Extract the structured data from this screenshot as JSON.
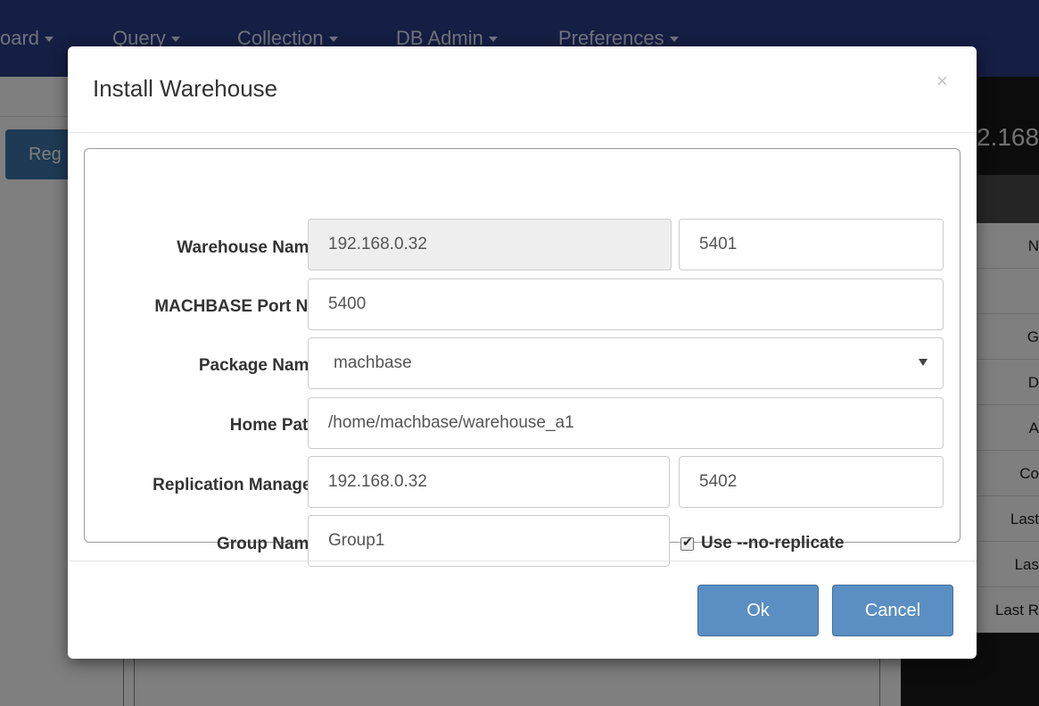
{
  "navbar": {
    "items": [
      {
        "label": "oard"
      },
      {
        "label": "Query"
      },
      {
        "label": "Collection"
      },
      {
        "label": "DB Admin"
      },
      {
        "label": "Preferences"
      }
    ]
  },
  "background": {
    "button_label": "Reg",
    "right_title": "2.168",
    "table_cells": [
      "N",
      "",
      "G",
      "D",
      "A",
      "Co",
      "Last",
      "Las",
      "Last R"
    ]
  },
  "modal": {
    "title": "Install Warehouse",
    "close_symbol": "×",
    "fields": {
      "warehouse_name": {
        "label": "Warehouse Name",
        "value": "192.168.0.32",
        "port": "5401"
      },
      "machbase_port": {
        "label": "MACHBASE Port No",
        "value": "5400"
      },
      "package_name": {
        "label": "Package Name",
        "value": "machbase"
      },
      "home_path": {
        "label": "Home Path",
        "value": "/home/machbase/warehouse_a1"
      },
      "replication_manager": {
        "label": "Replication Manager",
        "value": "192.168.0.32",
        "port": "5402"
      },
      "group_name": {
        "label": "Group Name",
        "value": "Group1"
      }
    },
    "no_replicate": {
      "label": "Use --no-replicate",
      "checked": true
    },
    "buttons": {
      "ok": "Ok",
      "cancel": "Cancel"
    }
  },
  "colors": {
    "navbar": "#2a3c86",
    "primary_button": "#5b8fc3",
    "overlay": "rgba(0,0,0,0.5)"
  }
}
